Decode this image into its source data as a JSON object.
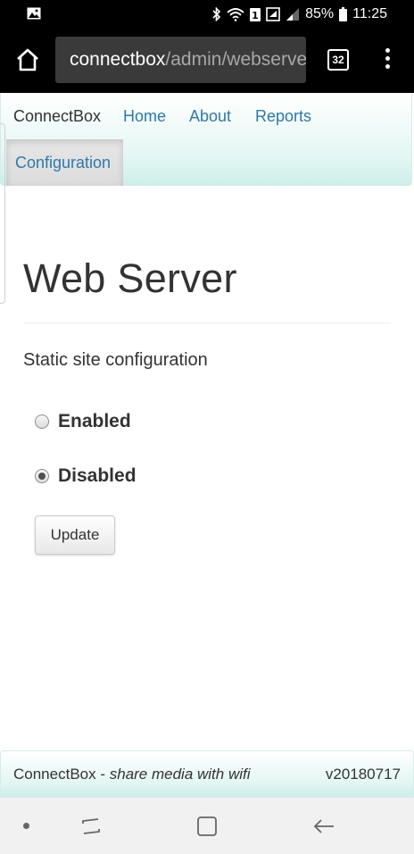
{
  "status_bar": {
    "battery": "85%",
    "time": "11:25",
    "icons": [
      "image-notification-icon",
      "bluetooth-icon",
      "wifi-icon",
      "sim-1-icon",
      "nfc-icon",
      "signal-icon",
      "battery-icon"
    ]
  },
  "browser": {
    "url_host": "connectbox",
    "url_path": "/admin/webserver",
    "tab_count": "32"
  },
  "navbar": {
    "brand": "ConnectBox",
    "links": [
      "Home",
      "About",
      "Reports",
      "Configuration"
    ],
    "active": "Configuration",
    "colors": {
      "link": "#2f78a8",
      "navbar_gradient_end": "#cdeee9"
    }
  },
  "main": {
    "title": "Web Server",
    "subtitle": "Static site configuration",
    "options": [
      {
        "label": "Enabled",
        "checked": false
      },
      {
        "label": "Disabled",
        "checked": true
      }
    ],
    "button": "Update"
  },
  "footer": {
    "brand": "ConnectBox",
    "separator": " - ",
    "tagline": "share media with wifi",
    "version": "v20180717"
  }
}
